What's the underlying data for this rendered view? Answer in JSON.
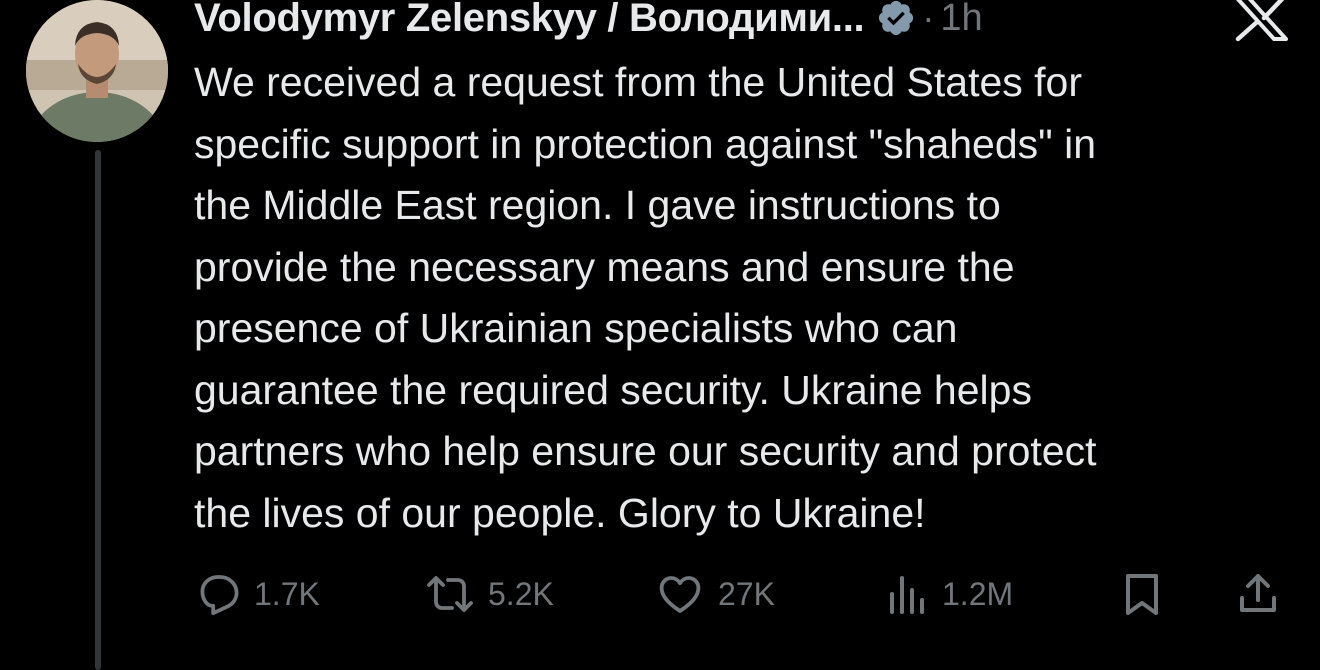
{
  "tweet": {
    "author_name": "Volodymyr Zelenskyy / Володими...",
    "verified": true,
    "separator": "·",
    "timestamp": "1h",
    "text": "We received a request from the United States for\nspecific support in protection against \"shaheds\" in\nthe Middle East region. I gave instructions to\nprovide the necessary means and ensure the\npresence of Ukrainian specialists who can\nguarantee the required security. Ukraine helps\npartners who help ensure our security and protect\nthe lives of our people. Glory to Ukraine!"
  },
  "actions": {
    "replies": "1.7K",
    "reposts": "5.2K",
    "likes": "27K",
    "views": "1.2M"
  },
  "icons": {
    "reply": "reply-icon",
    "repost": "repost-icon",
    "like": "heart-icon",
    "views": "views-icon",
    "bookmark": "bookmark-icon",
    "share": "share-icon",
    "verified": "verified-badge-icon",
    "brand": "x-logo-icon"
  },
  "colors": {
    "background": "#000000",
    "text": "#e7e9ea",
    "muted": "#71767b",
    "verified": "#829aab",
    "thread_line": "#333639"
  }
}
